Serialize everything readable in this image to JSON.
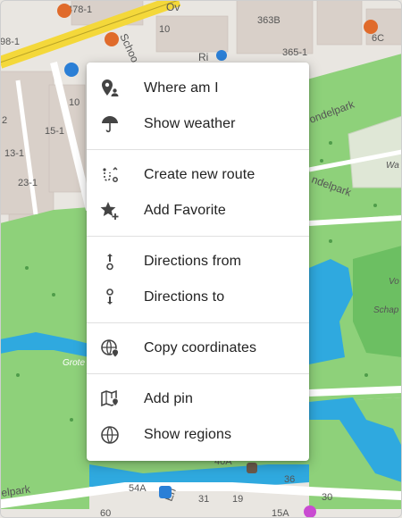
{
  "map": {
    "labels": {
      "house_478_1": "478-1",
      "house_363b": "363B",
      "house_365_1": "365-1",
      "house_6c": "6C",
      "house_98_1": "98-1",
      "house_10": "10",
      "house_10_top": "10",
      "house_15_1": "15-1",
      "house_13_1": "13-1",
      "house_23_1": "23-1",
      "house_2": "2",
      "house_40a": "40A",
      "house_54a": "54A",
      "house_36": "36",
      "house_31": "31",
      "house_19": "19",
      "house_30": "30",
      "house_15a": "15A",
      "house_60": "60",
      "street_ov": "Ov",
      "street_ri": "Ri",
      "street_schoo": "Schoo",
      "street_ndelpark": "ondelpark",
      "street_ndelpark2": "ndelpark",
      "street_elpark": "elpark",
      "street_en": "En",
      "water_grote": "Grote",
      "place_wa": "Wa",
      "place_vo": "Vo",
      "place_schap": "Schap"
    }
  },
  "menu": {
    "items": [
      {
        "label": "Where am I",
        "icon": "person-pin-icon"
      },
      {
        "label": "Show weather",
        "icon": "umbrella-icon"
      },
      {
        "label": "Create new route",
        "icon": "route-icon"
      },
      {
        "label": "Add Favorite",
        "icon": "star-plus-icon"
      },
      {
        "label": "Directions from",
        "icon": "directions-from-icon"
      },
      {
        "label": "Directions to",
        "icon": "directions-to-icon"
      },
      {
        "label": "Copy coordinates",
        "icon": "globe-pin-icon"
      },
      {
        "label": "Add pin",
        "icon": "map-pin-icon"
      },
      {
        "label": "Show regions",
        "icon": "globe-icon"
      }
    ]
  },
  "colors": {
    "park": "#8ed17a",
    "park_dark": "#6cbf62",
    "water": "#2fa9df",
    "road_major": "#f4d83a",
    "building": "#d9d0c9",
    "land": "#e9e6e1"
  }
}
